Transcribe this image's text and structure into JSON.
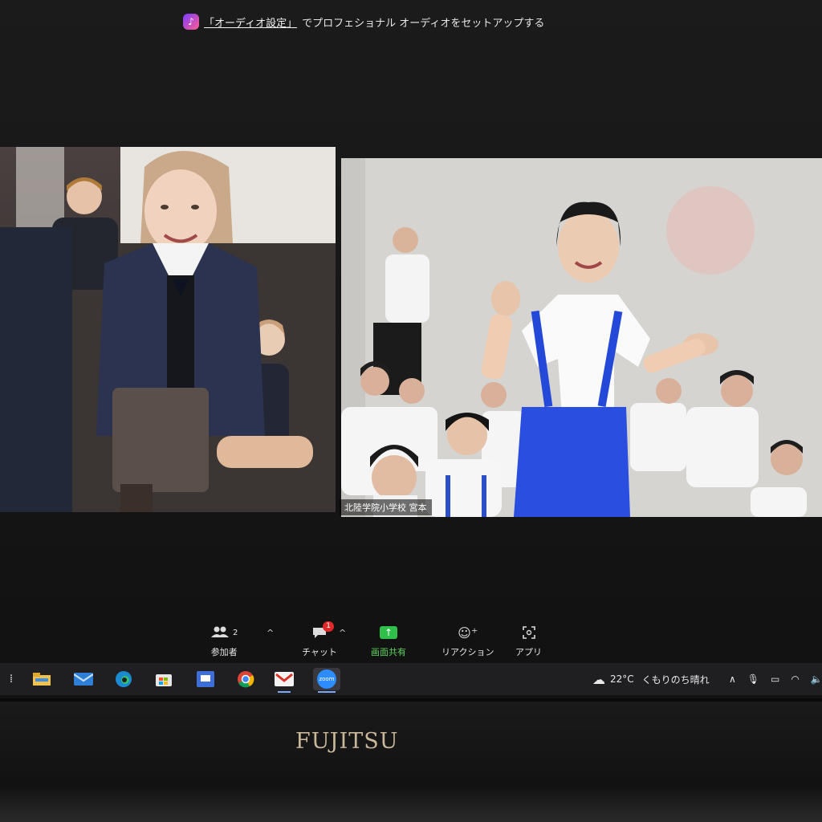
{
  "banner": {
    "link_text": "「オーディオ設定」",
    "rest_text": "でプロフェショナル オーディオをセットアップする",
    "icon": "audio-app-icon"
  },
  "video": {
    "left_tile": {
      "label": ""
    },
    "right_tile": {
      "name_label": "北陸学院小学校 宮本"
    }
  },
  "toolbar": {
    "participants": {
      "label": "参加者",
      "count": "2",
      "icon": "participants-icon"
    },
    "chat": {
      "label": "チャット",
      "badge": "1",
      "icon": "chat-icon"
    },
    "share": {
      "label": "画面共有",
      "icon": "share-screen-icon",
      "color": "#2fbf4a"
    },
    "reactions": {
      "label": "リアクション",
      "icon": "reaction-icon"
    },
    "apps": {
      "label": "アプリ",
      "icon": "apps-icon"
    }
  },
  "taskbar": {
    "apps": [
      "file-explorer",
      "mail",
      "edge",
      "store",
      "teams-screen",
      "chrome",
      "gmail",
      "zoom"
    ],
    "zoom_label": "zoom",
    "weather": {
      "temp": "22°C",
      "text": "くもりのち晴れ"
    }
  },
  "brand": "FUJITSU"
}
